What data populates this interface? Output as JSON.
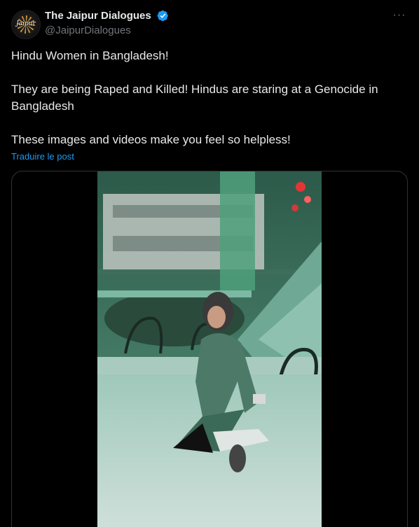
{
  "author": {
    "display_name": "The Jaipur Dialogues",
    "handle": "@JaipurDialogues",
    "avatar_text": "Jaipur",
    "verified": true
  },
  "post": {
    "paragraphs": [
      "Hindu Women in Bangladesh!",
      "They are being Raped and Killed! Hindus are staring at a Genocide in Bangladesh",
      "These images and videos make you feel so helpless!"
    ],
    "translate_label": "Traduire le post"
  },
  "more_label": "···",
  "icons": {
    "verified": "verified-badge-icon",
    "more": "more-icon"
  },
  "colors": {
    "background": "#000000",
    "text": "#e7e9ea",
    "secondary": "#71767b",
    "accent": "#1d9bf0",
    "border": "#2f3336"
  }
}
